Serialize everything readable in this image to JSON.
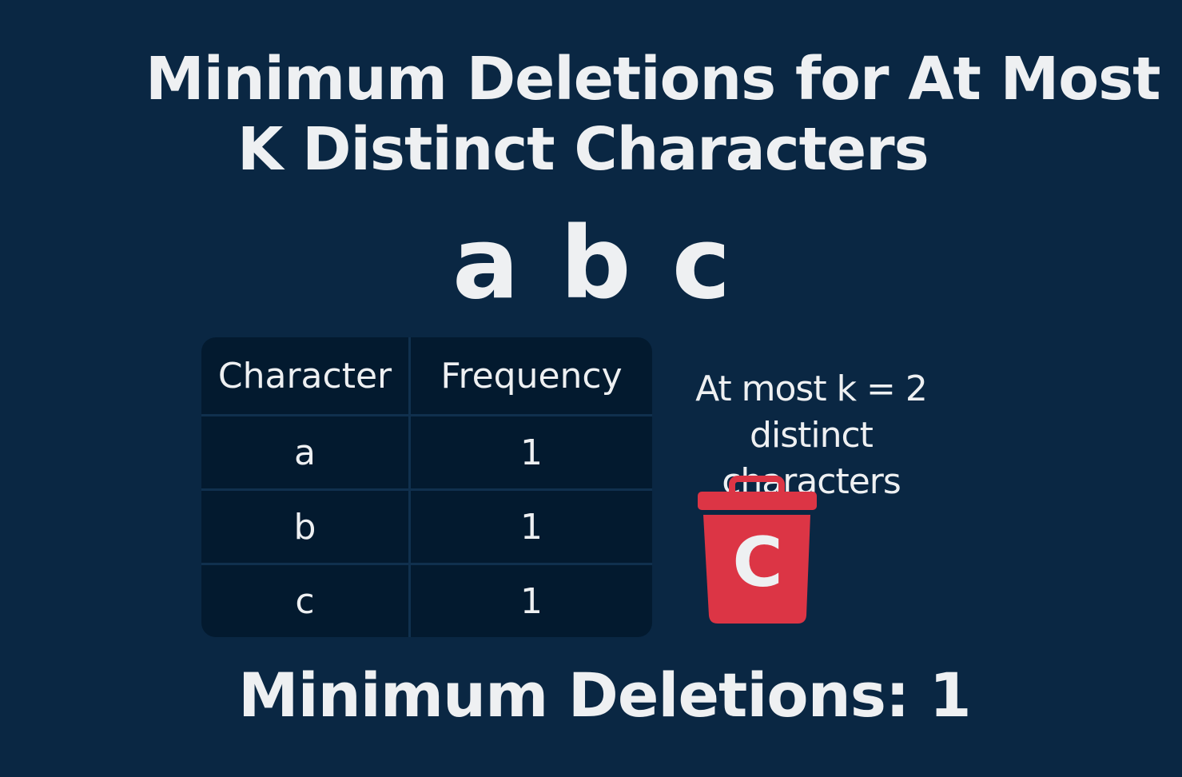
{
  "title": {
    "line1": "Minimum Deletions for At Most",
    "line2": "K Distinct Characters"
  },
  "input_string": "a b c",
  "table": {
    "headers": [
      "Character",
      "Frequency"
    ],
    "rows": [
      {
        "character": "a",
        "frequency": "1"
      },
      {
        "character": "b",
        "frequency": "1"
      },
      {
        "character": "c",
        "frequency": "1"
      }
    ]
  },
  "constraint": {
    "line1": "At most k = 2",
    "line2": "distinct characters"
  },
  "trash": {
    "label": "C",
    "icon": "trash-icon",
    "color": "#dc3545"
  },
  "result": "Minimum Deletions: 1",
  "colors": {
    "background": "#0a2743",
    "table": "#031a2f",
    "text": "#eef0f2"
  }
}
